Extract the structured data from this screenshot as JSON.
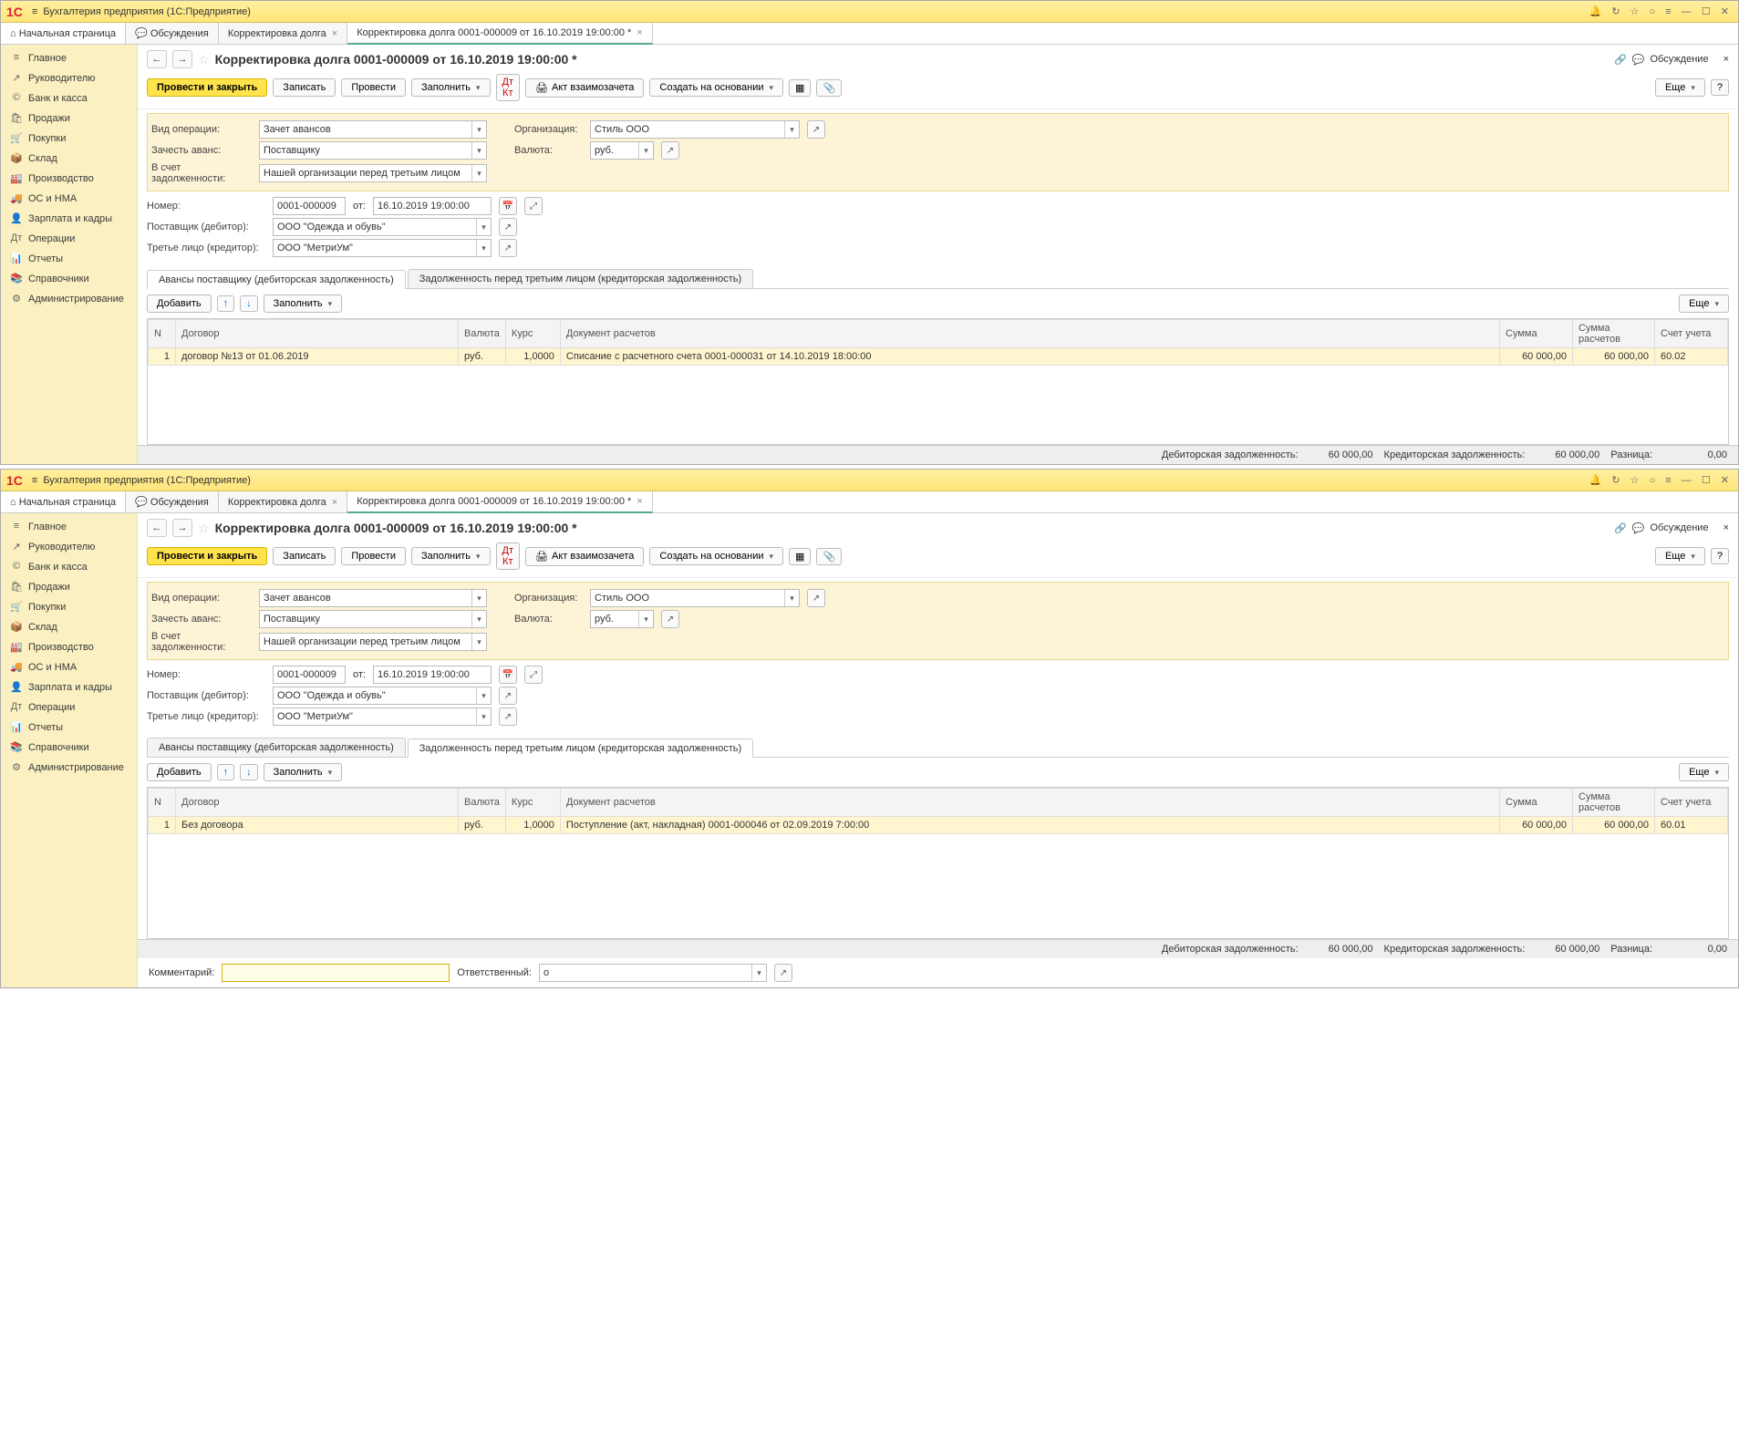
{
  "app_name": "Бухгалтерия предприятия  (1С:Предприятие)",
  "sidebar": {
    "items": [
      {
        "icon": "≡",
        "label": "Главное"
      },
      {
        "icon": "↗",
        "label": "Руководителю"
      },
      {
        "icon": "©",
        "label": "Банк и касса"
      },
      {
        "icon": "🛍",
        "label": "Продажи"
      },
      {
        "icon": "🛒",
        "label": "Покупки"
      },
      {
        "icon": "📦",
        "label": "Склад"
      },
      {
        "icon": "🏭",
        "label": "Производство"
      },
      {
        "icon": "🚚",
        "label": "ОС и НМА"
      },
      {
        "icon": "👤",
        "label": "Зарплата и кадры"
      },
      {
        "icon": "Дт",
        "label": "Операции"
      },
      {
        "icon": "📊",
        "label": "Отчеты"
      },
      {
        "icon": "📚",
        "label": "Справочники"
      },
      {
        "icon": "⚙",
        "label": "Администрирование"
      }
    ]
  },
  "home_tab": "Начальная страница",
  "tabs": [
    {
      "label": "Обсуждения",
      "closable": false,
      "icon": "💬"
    },
    {
      "label": "Корректировка долга",
      "closable": true
    },
    {
      "label": "Корректировка долга 0001-000009 от 16.10.2019 19:00:00 *",
      "closable": true,
      "active": true
    }
  ],
  "doc_title": "Корректировка долга 0001-000009 от 16.10.2019 19:00:00 *",
  "toolbar": {
    "post_close": "Провести и закрыть",
    "save": "Записать",
    "post": "Провести",
    "fill": "Заполнить",
    "act": "Акт взаимозачета",
    "create_based": "Создать на основании",
    "more": "Еще",
    "help": "?",
    "discuss": "Обсуждение"
  },
  "labels": {
    "op_type": "Вид операции:",
    "offset": "Зачесть аванс:",
    "debt_for": "В счет задолженности:",
    "number": "Номер:",
    "from": "от:",
    "supplier": "Поставщик (дебитор):",
    "third": "Третье лицо (кредитор):",
    "org": "Организация:",
    "currency": "Валюта:",
    "comment": "Комментарий:",
    "responsible": "Ответственный:"
  },
  "form": {
    "op_type": "Зачет авансов",
    "offset": "Поставщику",
    "debt_for": "Нашей организации перед третьим лицом",
    "number": "0001-000009",
    "date": "16.10.2019 19:00:00",
    "supplier": "ООО \"Одежда и обувь\"",
    "third": "ООО \"МетриУм\"",
    "org": "Стиль ООО",
    "currency": "руб.",
    "comment": "",
    "responsible": "о"
  },
  "subtabs": {
    "a": "Авансы поставщику (дебиторская задолженность)",
    "b": "Задолженность перед третьим лицом (кредиторская задолженность)"
  },
  "tabletoolbar": {
    "add": "Добавить",
    "fill": "Заполнить"
  },
  "columns": {
    "n": "N",
    "contract": "Договор",
    "currency": "Валюта",
    "rate": "Курс",
    "doc": "Документ расчетов",
    "sum": "Сумма",
    "sum_calc": "Сумма расчетов",
    "account": "Счет учета"
  },
  "instance1": {
    "active_subtab": "a",
    "rows": [
      {
        "n": "1",
        "contract": "договор №13 от 01.06.2019",
        "currency": "руб.",
        "rate": "1,0000",
        "doc": "Списание с расчетного счета 0001-000031 от 14.10.2019 18:00:00",
        "sum": "60 000,00",
        "sum_calc": "60 000,00",
        "account": "60.02"
      }
    ]
  },
  "instance2": {
    "active_subtab": "b",
    "rows": [
      {
        "n": "1",
        "contract": "Без договора",
        "currency": "руб.",
        "rate": "1,0000",
        "doc": "Поступление (акт, накладная) 0001-000046 от 02.09.2019 7:00:00",
        "sum": "60 000,00",
        "sum_calc": "60 000,00",
        "account": "60.01"
      }
    ]
  },
  "status": {
    "dr_label": "Дебиторская задолженность:",
    "dr_val": "60 000,00",
    "cr_label": "Кредиторская задолженность:",
    "cr_val": "60 000,00",
    "diff_label": "Разница:",
    "diff_val": "0,00"
  }
}
